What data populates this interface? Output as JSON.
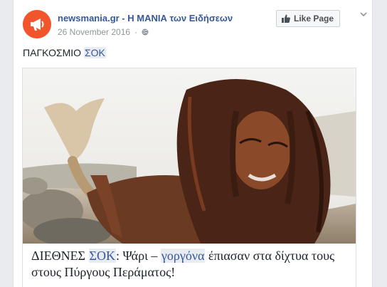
{
  "post": {
    "page_name": "newsmania.gr - Η ΜΑΝΙΑ των Ειδήσεων",
    "date": "26 November 2016",
    "like_page_label": "Like Page",
    "text_prefix": "ΠΑΓΚΟΣΜΙΟ ",
    "text_highlight": "ΣΟΚ"
  },
  "link": {
    "headline_part1": "ΔΙΕΘΝΕΣ ",
    "headline_hl1": "ΣΟΚ",
    "headline_part2": ": Ψάρι – ",
    "headline_hl2": "γοργόνα",
    "headline_part3": " έπιασαν στα δίχτυα τους στους Πύργους Περάματος!"
  },
  "colors": {
    "brand_orange": "#f2552c",
    "link_blue": "#365899",
    "highlight_bg": "#e9ebf3"
  },
  "icons": {
    "avatar": "megaphone-icon",
    "privacy": "globe-icon",
    "like": "thumbs-up-icon",
    "menu": "chevron-down-icon"
  }
}
